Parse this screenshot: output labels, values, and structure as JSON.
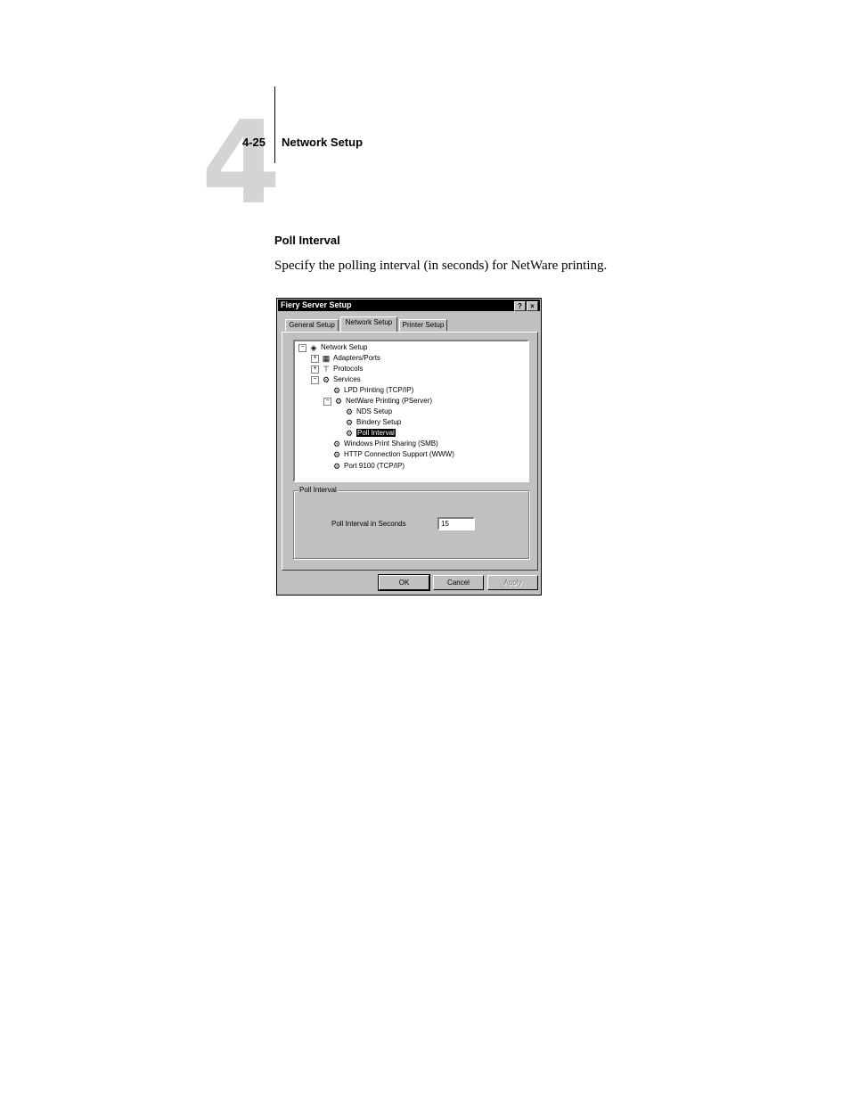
{
  "header": {
    "chapter_number": "4",
    "page_number": "4-25",
    "title": "Network Setup"
  },
  "section": {
    "heading": "Poll Interval",
    "body": "Specify the polling interval (in seconds) for NetWare printing."
  },
  "dialog": {
    "title": "Fiery Server Setup",
    "help_glyph": "?",
    "close_glyph": "×",
    "tabs": [
      "General Setup",
      "Network Setup",
      "Printer Setup"
    ],
    "active_tab": "Network Setup",
    "tree": [
      {
        "label": "Network Setup",
        "expander": "⊟",
        "icon": "network-icon"
      },
      {
        "label": "Adapters/Ports",
        "expander": "⊞",
        "icon": "adapter-icon"
      },
      {
        "label": "Protocols",
        "expander": "⊞",
        "icon": "protocol-icon"
      },
      {
        "label": "Services",
        "expander": "⊟",
        "icon": "services-icon"
      },
      {
        "label": "LPD Printing (TCP/IP)",
        "icon": "service-icon"
      },
      {
        "label": "NetWare Printing (PServer)",
        "expander": "⊟",
        "icon": "service-icon"
      },
      {
        "label": "NDS Setup",
        "icon": "service-icon"
      },
      {
        "label": "Bindery Setup",
        "icon": "service-icon"
      },
      {
        "label": "Poll Interval",
        "icon": "service-icon",
        "selected": true
      },
      {
        "label": "Windows Print Sharing (SMB)",
        "icon": "service-icon"
      },
      {
        "label": "HTTP Connection Support (WWW)",
        "icon": "service-icon"
      },
      {
        "label": "Port 9100 (TCP/IP)",
        "icon": "service-icon"
      }
    ],
    "group": {
      "legend": "Poll Interval",
      "field_label": "Poll Interval in Seconds",
      "field_value": "15"
    },
    "buttons": {
      "ok": "OK",
      "cancel": "Cancel",
      "apply": "Apply"
    }
  }
}
